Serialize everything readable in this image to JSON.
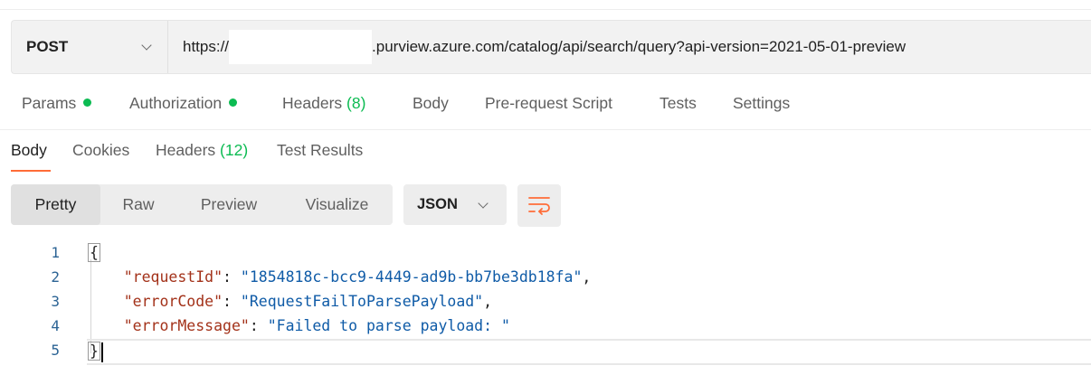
{
  "request": {
    "method": "POST",
    "url_prefix": "https://",
    "url_suffix": ".purview.azure.com/catalog/api/search/query?api-version=2021-05-01-preview"
  },
  "request_tabs": [
    {
      "label": "Params",
      "indicator": "dot"
    },
    {
      "label": "Authorization",
      "indicator": "dot"
    },
    {
      "label": "Headers",
      "count": "(8)"
    },
    {
      "label": "Body"
    },
    {
      "label": "Pre-request Script"
    },
    {
      "label": "Tests"
    },
    {
      "label": "Settings"
    }
  ],
  "response_tabs": [
    {
      "label": "Body",
      "active": true
    },
    {
      "label": "Cookies"
    },
    {
      "label": "Headers",
      "count": "(12)"
    },
    {
      "label": "Test Results"
    }
  ],
  "view_modes": {
    "items": [
      "Pretty",
      "Raw",
      "Preview",
      "Visualize"
    ],
    "selected": "Pretty"
  },
  "format": {
    "selected": "JSON"
  },
  "wrap_button": {
    "icon": "wrap-lines-icon"
  },
  "editor": {
    "line_numbers": [
      "1",
      "2",
      "3",
      "4",
      "5"
    ],
    "open_brace": "{",
    "close_brace": "}",
    "entries": [
      {
        "key": "\"requestId\"",
        "value": "\"1854818c-bcc9-4449-ad9b-bb7be3db18fa\"",
        "trail": ","
      },
      {
        "key": "\"errorCode\"",
        "value": "\"RequestFailToParsePayload\"",
        "trail": ","
      },
      {
        "key": "\"errorMessage\"",
        "value": "\"Failed to parse payload: \"",
        "trail": ""
      }
    ]
  },
  "colors": {
    "accent": "#ff6c37",
    "status_green": "#0cbb52",
    "json_key": "#a3321a",
    "json_string": "#0f5ba7"
  }
}
